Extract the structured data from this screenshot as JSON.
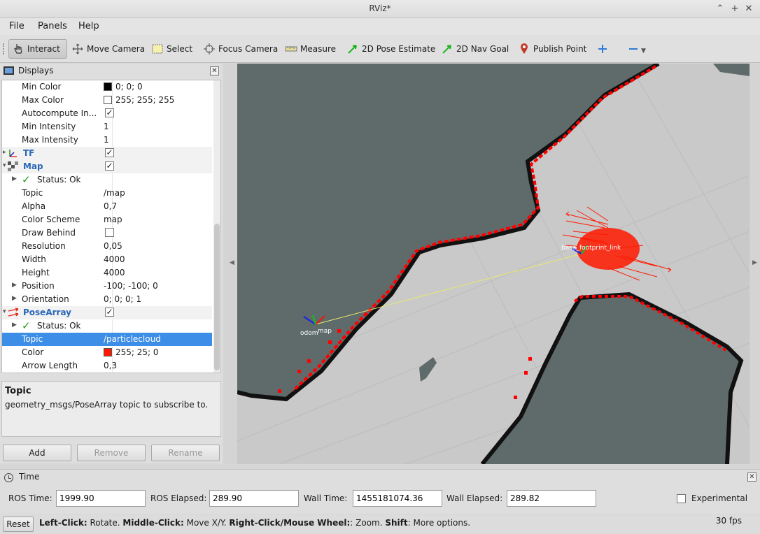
{
  "window": {
    "title": "RViz*"
  },
  "menu": {
    "file": "File",
    "panels": "Panels",
    "help": "Help"
  },
  "toolbar": {
    "interact": "Interact",
    "move_camera": "Move Camera",
    "select": "Select",
    "focus_camera": "Focus Camera",
    "measure": "Measure",
    "pose_estimate": "2D Pose Estimate",
    "nav_goal": "2D Nav Goal",
    "publish_point": "Publish Point"
  },
  "displays_panel": {
    "title": "Displays",
    "rows": {
      "min_color": {
        "name": "Min Color",
        "value": "0; 0; 0"
      },
      "max_color": {
        "name": "Max Color",
        "value": "255; 255; 255"
      },
      "autocompute": {
        "name": "Autocompute In..."
      },
      "min_intensity": {
        "name": "Min Intensity",
        "value": "1"
      },
      "max_intensity": {
        "name": "Max Intensity",
        "value": "1"
      },
      "tf": {
        "name": "TF"
      },
      "map": {
        "name": "Map"
      },
      "map_status": {
        "name": "Status: Ok"
      },
      "map_topic": {
        "name": "Topic",
        "value": "/map"
      },
      "alpha": {
        "name": "Alpha",
        "value": "0,7"
      },
      "color_scheme": {
        "name": "Color Scheme",
        "value": "map"
      },
      "draw_behind": {
        "name": "Draw Behind"
      },
      "resolution": {
        "name": "Resolution",
        "value": "0,05"
      },
      "width": {
        "name": "Width",
        "value": "4000"
      },
      "height": {
        "name": "Height",
        "value": "4000"
      },
      "position": {
        "name": "Position",
        "value": "-100; -100; 0"
      },
      "orientation": {
        "name": "Orientation",
        "value": "0; 0; 0; 1"
      },
      "posearray": {
        "name": "PoseArray"
      },
      "pa_status": {
        "name": "Status: Ok"
      },
      "pa_topic": {
        "name": "Topic",
        "value": "/particlecloud"
      },
      "pa_color": {
        "name": "Color",
        "value": "255; 25; 0"
      },
      "arrow_length": {
        "name": "Arrow Length",
        "value": "0,3"
      }
    },
    "help_title": "Topic",
    "help_desc": "geometry_msgs/PoseArray topic to subscribe to.",
    "add_button": "Add",
    "remove_button": "Remove",
    "rename_button": "Rename"
  },
  "viewport": {
    "labels": {
      "odom": "odom",
      "map": "map",
      "base": "base_footprint_link"
    }
  },
  "time_panel": {
    "title": "Time",
    "ros_time_label": "ROS Time:",
    "ros_time": "1999.90",
    "ros_elapsed_label": "ROS Elapsed:",
    "ros_elapsed": "289.90",
    "wall_time_label": "Wall Time:",
    "wall_time": "1455181074.36",
    "wall_elapsed_label": "Wall Elapsed:",
    "wall_elapsed": "289.82",
    "experimental_label": "Experimental"
  },
  "status_bar": {
    "reset": "Reset",
    "lc_key": "Left-Click:",
    "lc_txt": " Rotate. ",
    "mc_key": "Middle-Click:",
    "mc_txt": " Move X/Y. ",
    "rc_key": "Right-Click/Mouse Wheel:",
    "rc_txt": ": Zoom. ",
    "shift_key": "Shift",
    "shift_txt": ": More options.",
    "fps": "30 fps"
  },
  "colors": {
    "particle": "#ff1900",
    "laser": "#ff0000",
    "selection": "#3d8ee6"
  }
}
